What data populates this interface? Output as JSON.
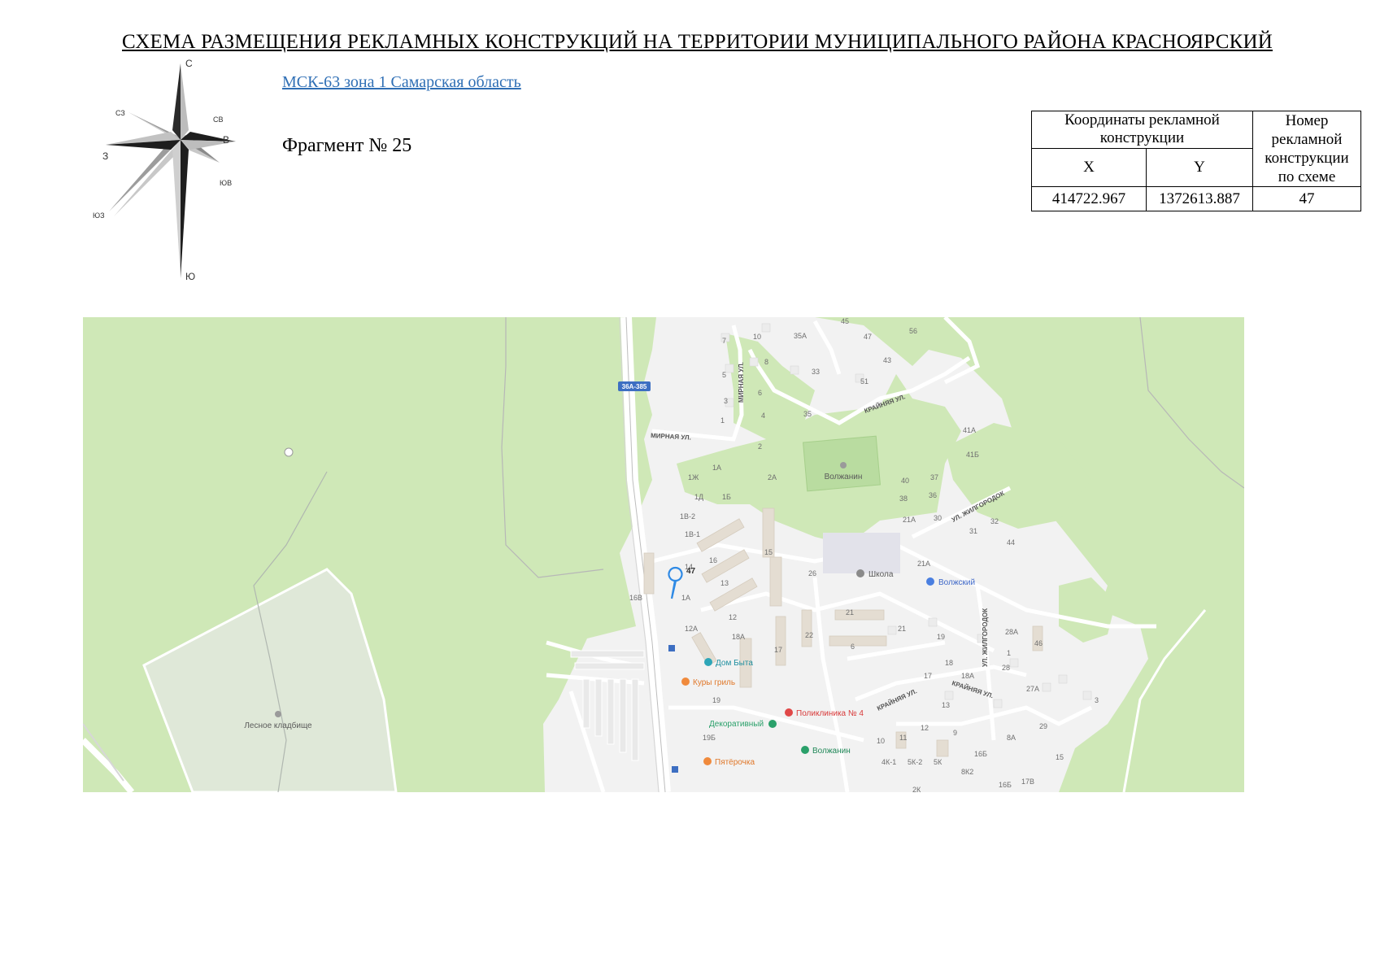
{
  "header": {
    "title": "СХЕМА РАЗМЕЩЕНИЯ РЕКЛАМНЫХ КОНСТРУКЦИЙ НА ТЕРРИТОРИИ МУНИЦИПАЛЬНОГО РАЙОНА КРАСНОЯРСКИЙ",
    "crs_link": "МСК-63 зона 1 Самарская область",
    "fragment": "Фрагмент № 25"
  },
  "compass": {
    "n": "С",
    "s": "Ю",
    "e": "В",
    "w": "З",
    "ne": "СВ",
    "nw": "СЗ",
    "se": "ЮВ",
    "sw": "ЮЗ"
  },
  "coords_table": {
    "header_coords": "Координаты рекламной конструкции",
    "header_number": "Номер рекламной конструкции по схеме",
    "col_x": "X",
    "col_y": "Y",
    "row": {
      "x": "414722.967",
      "y": "1372613.887",
      "number": "47"
    }
  },
  "map": {
    "colors": {
      "forest": "#cfe8b7",
      "urban": "#f2f2f2",
      "building": "#e4ddd2",
      "road": "#ffffff",
      "cemetery": "#dfe8d8",
      "marker": "#2f8ae5"
    },
    "marker": {
      "label": "47"
    },
    "road_shield": "36А-385",
    "streets": {
      "mirnaya": "МИРНАЯ УЛ.",
      "mirnaya_v": "МИРНАЯ УЛ.",
      "krainyaya": "КРАЙНЯЯ УЛ.",
      "zhilgorodok": "УЛ. ЖИЛГОРОДОК",
      "krainyaya2": "КРАЙНЯЯ УЛ.",
      "krainyaya3": "КРАЙНЯЯ УЛ.",
      "zhilgorodok_v": "УЛ. ЖИЛГОРОДОК"
    },
    "pois": {
      "volzhanin_top": "Волжанин",
      "shkola": "Школа",
      "volzhsky": "Волжский",
      "dom_byta": "Дом Быта",
      "kury_gril": "Куры гриль",
      "poliklinika": "Поликлиника № 4",
      "dekorativny": "Декоративный",
      "volzhanin_bottom": "Волжанин",
      "pyaterochka": "Пятёрочка",
      "lesnoe_kladbishche": "Лесное кладбище"
    },
    "house_numbers": {
      "h7": "7",
      "h10": "10",
      "h35a": "35А",
      "h45": "45",
      "h47": "47",
      "h56": "56",
      "h8": "8",
      "h5": "5",
      "h33": "33",
      "h43": "43",
      "h6": "6",
      "h51": "51",
      "h3": "3",
      "h4": "4",
      "h35": "35",
      "h1": "1",
      "h41a": "41А",
      "h2": "2",
      "h41b": "41Б",
      "h1a": "1А",
      "h1zh": "1Ж",
      "h2a": "2А",
      "h40": "40",
      "h37": "37",
      "h1d": "1Д",
      "h1b": "1Б",
      "h38": "38",
      "h36": "36",
      "h1v2": "1В-2",
      "h21a": "21А",
      "h30": "30",
      "h32": "32",
      "h1v1": "1В-1",
      "h31": "31",
      "h44": "44",
      "h15": "15",
      "h16": "16",
      "h14": "14",
      "h26": "26",
      "h21a2": "21А",
      "h16v": "16В",
      "h13": "13",
      "h1a2": "1А",
      "h21": "21",
      "h12": "12",
      "h28a": "28А",
      "h12a": "12А",
      "h18a": "18А",
      "h22": "22",
      "h21b": "21",
      "h19": "19",
      "h46": "46",
      "h17": "17",
      "h6b": "6",
      "h1c": "1",
      "h28": "28",
      "h18": "18",
      "h18a2": "18А",
      "h17b": "17",
      "h27a": "27А",
      "h19b": "19",
      "h13b": "13",
      "h3b": "3",
      "h9": "9",
      "h12b": "12",
      "h29": "29",
      "h8a": "8А",
      "h19b2": "19Б",
      "h10b": "10",
      "h11": "11",
      "h16b": "16Б",
      "h15b": "15",
      "h4k1": "4К-1",
      "h5k2": "5К-2",
      "h5k": "5К",
      "h8k2": "8К2",
      "h16b2": "16Б",
      "h17v": "17В",
      "h2k": "2К"
    }
  }
}
